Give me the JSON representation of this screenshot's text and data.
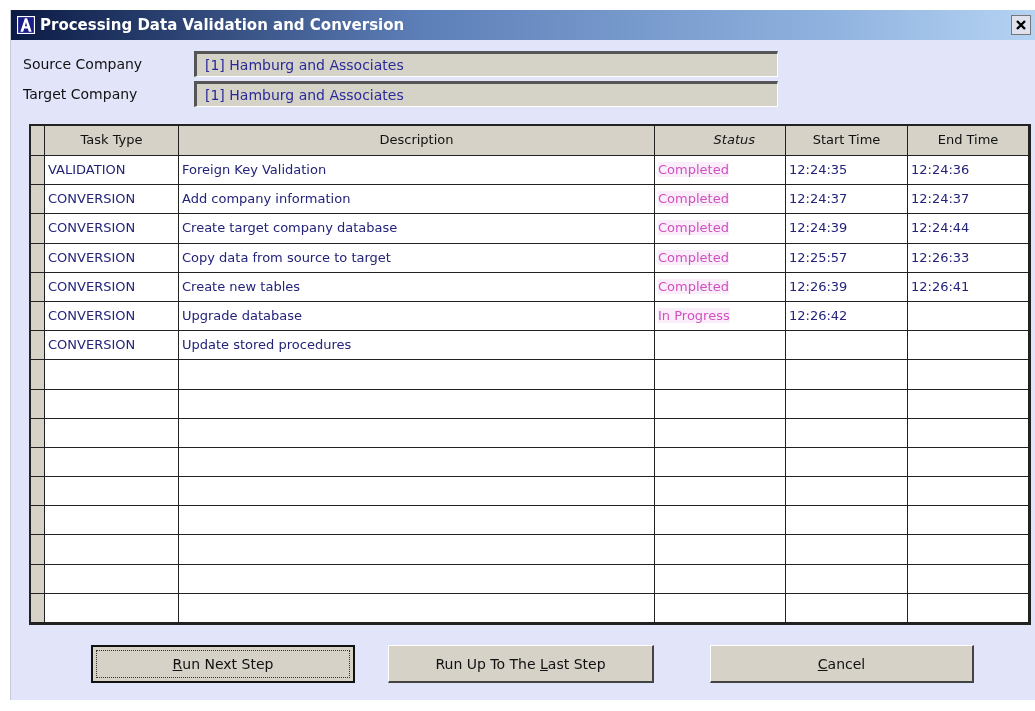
{
  "window": {
    "title": "Processing Data Validation and Conversion"
  },
  "fields": [
    {
      "label": "Source Company",
      "value": "[1] Hamburg and Associates"
    },
    {
      "label": "Target Company",
      "value": "[1] Hamburg and Associates"
    }
  ],
  "table": {
    "columns": [
      {
        "label": "Task Type",
        "italic": false
      },
      {
        "label": "Description",
        "italic": false
      },
      {
        "label": "Status",
        "italic": true
      },
      {
        "label": "Start Time",
        "italic": false
      },
      {
        "label": "End Time",
        "italic": false
      }
    ],
    "rows": [
      {
        "task_type": "VALIDATION",
        "description": "Foreign Key Validation",
        "status": "Completed",
        "start_time": "12:24:35",
        "end_time": "12:24:36"
      },
      {
        "task_type": "CONVERSION",
        "description": "Add company information",
        "status": "Completed",
        "start_time": "12:24:37",
        "end_time": "12:24:37"
      },
      {
        "task_type": "CONVERSION",
        "description": "Create target company database",
        "status": "Completed",
        "start_time": "12:24:39",
        "end_time": "12:24:44"
      },
      {
        "task_type": "CONVERSION",
        "description": "Copy data from source to target",
        "status": "Completed",
        "start_time": "12:25:57",
        "end_time": "12:26:33"
      },
      {
        "task_type": "CONVERSION",
        "description": "Create new tables",
        "status": "Completed",
        "start_time": "12:26:39",
        "end_time": "12:26:41"
      },
      {
        "task_type": "CONVERSION",
        "description": "Upgrade database",
        "status": "In Progress",
        "start_time": "12:26:42"
      },
      {
        "task_type": "CONVERSION",
        "description": "Update stored procedures"
      }
    ]
  },
  "buttons": [
    {
      "key": "R",
      "after": "un Next Step",
      "focused": true
    },
    {
      "before": "Run Up To The ",
      "key": "L",
      "after": "ast Step",
      "focused": false
    },
    {
      "key": "C",
      "after": "ancel",
      "focused": false
    }
  ]
}
